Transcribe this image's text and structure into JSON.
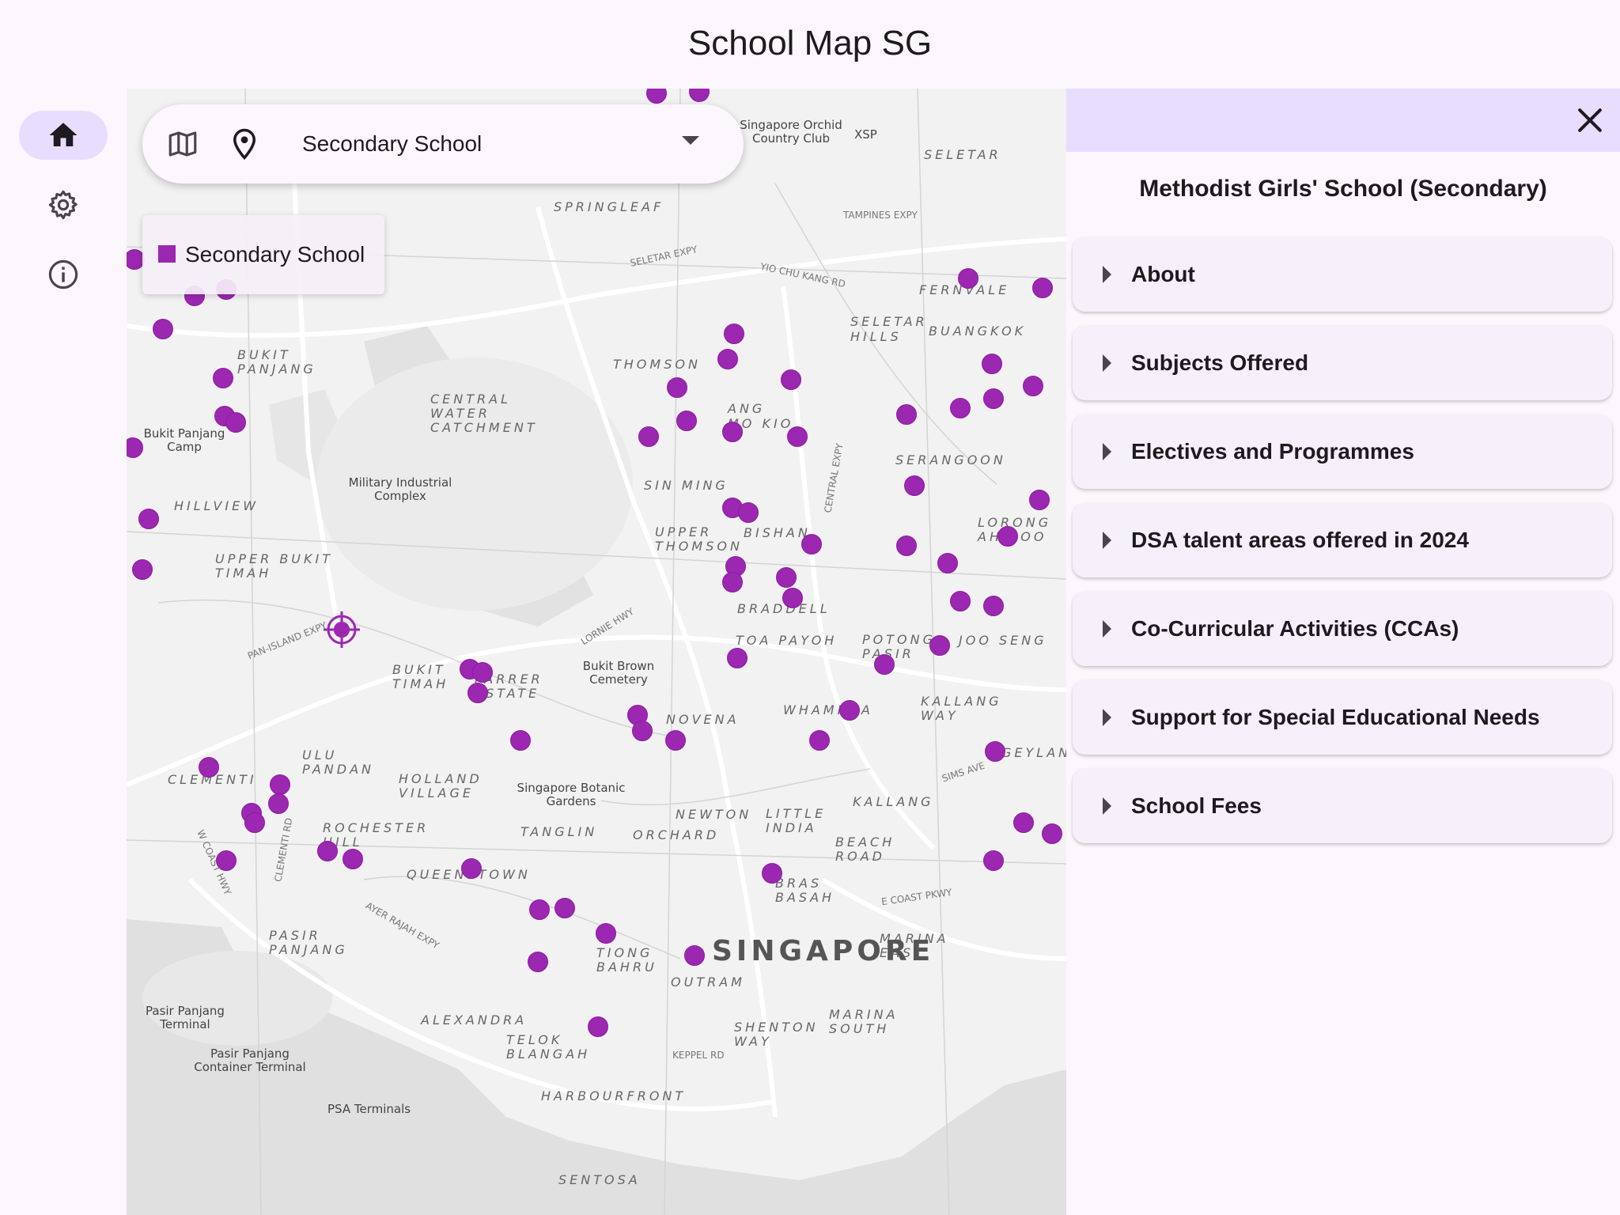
{
  "app": {
    "title": "School Map SG"
  },
  "nav_rail": [
    {
      "name": "home",
      "icon": "home-icon",
      "active": true
    },
    {
      "name": "settings",
      "icon": "gear-icon",
      "active": false
    },
    {
      "name": "about",
      "icon": "info-icon",
      "active": false
    }
  ],
  "search": {
    "selected_value": "Secondary School",
    "map_icon": "map-icon",
    "pin_icon": "location-pin-icon"
  },
  "legend": {
    "label": "Secondary School",
    "color": "#9c27b0"
  },
  "map": {
    "area_labels": [
      "SELETAR",
      "SPRINGLEAF",
      "FERNVALE",
      "SELETAR HILLS",
      "BUANGKOK",
      "THOMSON",
      "ANG MO KIO",
      "CENTRAL WATER CATCHMENT",
      "BUKIT PANJANG",
      "SERANGOON",
      "SIN MING",
      "UPPER THOMSON",
      "BISHAN",
      "HILLVIEW",
      "UPPER BUKIT TIMAH",
      "LORONG AH SOO",
      "BRADDELL",
      "TOA PAYOH",
      "POTONG PASIR",
      "JOO SENG",
      "BUKIT TIMAH",
      "FARRER ESTATE",
      "NOVENA",
      "WHAMPOA",
      "KALLANG WAY",
      "ULU PANDAN",
      "CLEMENTI",
      "HOLLAND VILLAGE",
      "GEYLANG",
      "KALLANG",
      "NEWTON",
      "LITTLE INDIA",
      "ROCHESTER HILL",
      "TANGLIN",
      "ORCHARD",
      "BEACH ROAD",
      "QUEENSTOWN",
      "BRAS BASAH",
      "PASIR PANJANG",
      "TIONG BAHRU",
      "OUTRAM",
      "MARINA EAST",
      "ALEXANDRA",
      "SHENTON WAY",
      "MARINA SOUTH",
      "TELOK BLANGAH",
      "HARBOURFRONT",
      "SENTOSA"
    ],
    "city_label": "SINGAPORE",
    "poi_labels": [
      "Singapore Orchid Country Club",
      "XSP",
      "Bukit Panjang Camp",
      "Military Industrial Complex",
      "Bukit Brown Cemetery",
      "Singapore Botanic Gardens",
      "Pasir Panjang Terminal",
      "Pasir Panjang Container Terminal",
      "PSA Terminals"
    ],
    "road_labels": [
      "SELETAR EXPY",
      "TAMPINES EXPY",
      "YIO CHU KANG RD",
      "CENTRAL EXPY",
      "PAN-ISLAND EXPY",
      "LORNIE HWY",
      "AYER RAJAH EXPY",
      "E COAST PKWY",
      "KEPPEL RD",
      "SIMS AVE",
      "W COAST HWY",
      "CLEMENTI RD"
    ],
    "school_marker_color": "#9c27b0"
  },
  "panel": {
    "school_name": "Methodist Girls' School (Secondary)",
    "sections": [
      {
        "label": "About"
      },
      {
        "label": "Subjects Offered"
      },
      {
        "label": "Electives and Programmes"
      },
      {
        "label": "DSA talent areas offered in 2024"
      },
      {
        "label": "Co-Curricular Activities (CCAs)"
      },
      {
        "label": "Support for Special Educational Needs"
      },
      {
        "label": "School Fees"
      }
    ]
  }
}
